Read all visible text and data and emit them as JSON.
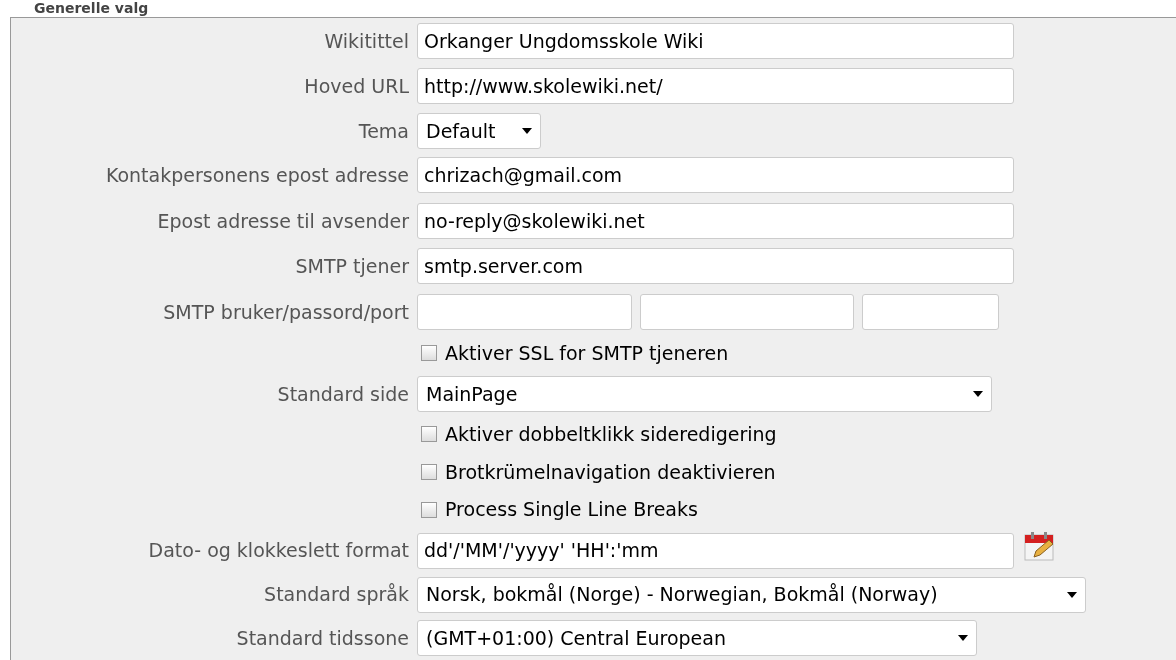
{
  "section_title": "Generelle valg",
  "rows": [
    {
      "kind": "text",
      "label": "Wikitittel",
      "value": "Orkanger Ungdomsskole Wiki"
    },
    {
      "kind": "text",
      "label": "Hoved URL",
      "value": "http://www.skolewiki.net/"
    },
    {
      "kind": "select",
      "label": "Tema",
      "value": "Default"
    },
    {
      "kind": "text",
      "label": "Kontakpersonens epost adresse",
      "value": "chrizach@gmail.com"
    },
    {
      "kind": "text",
      "label": "Epost adresse til avsender",
      "value": "no-reply@skolewiki.net"
    },
    {
      "kind": "text",
      "label": "SMTP tjener",
      "value": "smtp.server.com"
    },
    {
      "kind": "triple",
      "label": "SMTP bruker/passord/port"
    },
    {
      "kind": "checkbox",
      "label": "Aktiver SSL for SMTP tjeneren",
      "checked": false
    },
    {
      "kind": "select",
      "label": "Standard side",
      "value": "MainPage"
    },
    {
      "kind": "checkbox",
      "label": "Aktiver dobbeltklikk sideredigering",
      "checked": false
    },
    {
      "kind": "checkbox",
      "label": "Brotkrümelnavigation deaktivieren",
      "checked": false
    },
    {
      "kind": "checkbox",
      "label": "Process Single Line Breaks",
      "checked": false
    },
    {
      "kind": "date",
      "label": "Dato- og klokkeslett format",
      "value": "dd'/'MM'/'yyyy' 'HH':'mm"
    },
    {
      "kind": "select",
      "label": "Standard språk",
      "value": "Norsk, bokmål (Norge) - Norwegian, Bokmål (Norway)"
    },
    {
      "kind": "select",
      "label": "Standard tidssone",
      "value": "(GMT+01:00) Central European"
    }
  ]
}
